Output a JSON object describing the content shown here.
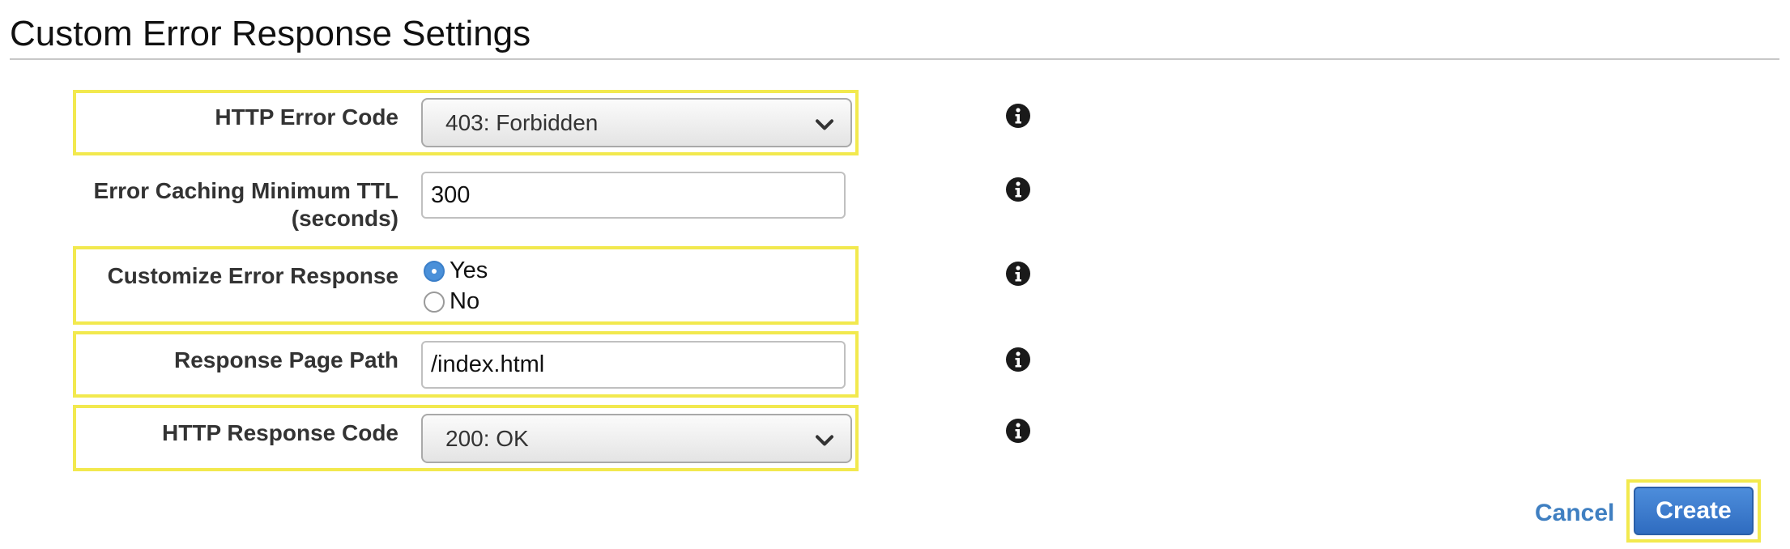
{
  "page": {
    "title": "Custom Error Response Settings"
  },
  "form": {
    "http_error_code": {
      "label": "HTTP Error Code",
      "value": "403: Forbidden"
    },
    "error_caching_ttl": {
      "label_line1": "Error Caching Minimum TTL",
      "label_line2": "(seconds)",
      "value": "300"
    },
    "customize_error_response": {
      "label": "Customize Error Response",
      "options": [
        "Yes",
        "No"
      ],
      "selected": "Yes"
    },
    "response_page_path": {
      "label": "Response Page Path",
      "value": "/index.html"
    },
    "http_response_code": {
      "label": "HTTP Response Code",
      "value": "200: OK"
    }
  },
  "actions": {
    "cancel_label": "Cancel",
    "create_label": "Create"
  },
  "colors": {
    "highlight": "#f2e94e",
    "accent_blue": "#3f7fc1",
    "button_blue": "#2f6cc0"
  },
  "icons": {
    "info": "info-circle-icon",
    "chevron": "chevron-down-icon"
  }
}
